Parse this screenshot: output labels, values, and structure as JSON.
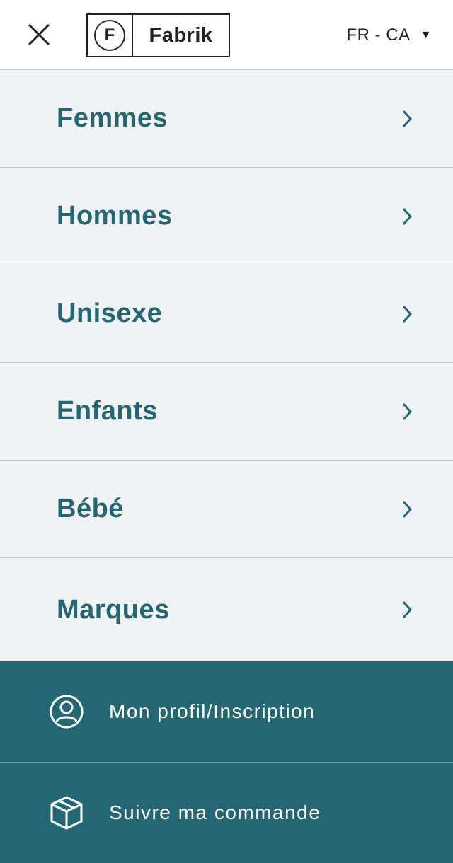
{
  "header": {
    "close_icon": "close-icon",
    "logo": {
      "mark_letter": "F",
      "wordmark": "Fabrik"
    },
    "language": {
      "label": "FR - CA",
      "caret_icon": "caret-down-icon"
    }
  },
  "menu": {
    "items": [
      {
        "label": "Femmes",
        "icon": "chevron-right-icon"
      },
      {
        "label": "Hommes",
        "icon": "chevron-right-icon"
      },
      {
        "label": "Unisexe",
        "icon": "chevron-right-icon"
      },
      {
        "label": "Enfants",
        "icon": "chevron-right-icon"
      },
      {
        "label": "Bébé",
        "icon": "chevron-right-icon"
      },
      {
        "label": "Marques",
        "icon": "chevron-right-icon"
      }
    ]
  },
  "footer": {
    "profile": {
      "label": "Mon profil/Inscription",
      "icon": "user-icon"
    },
    "track_order": {
      "label": "Suivre ma commande",
      "icon": "package-icon"
    }
  },
  "colors": {
    "accent": "#246672",
    "menu_background": "#f0f3f5",
    "divider": "#b9ccd5",
    "text_dark": "#222222"
  }
}
